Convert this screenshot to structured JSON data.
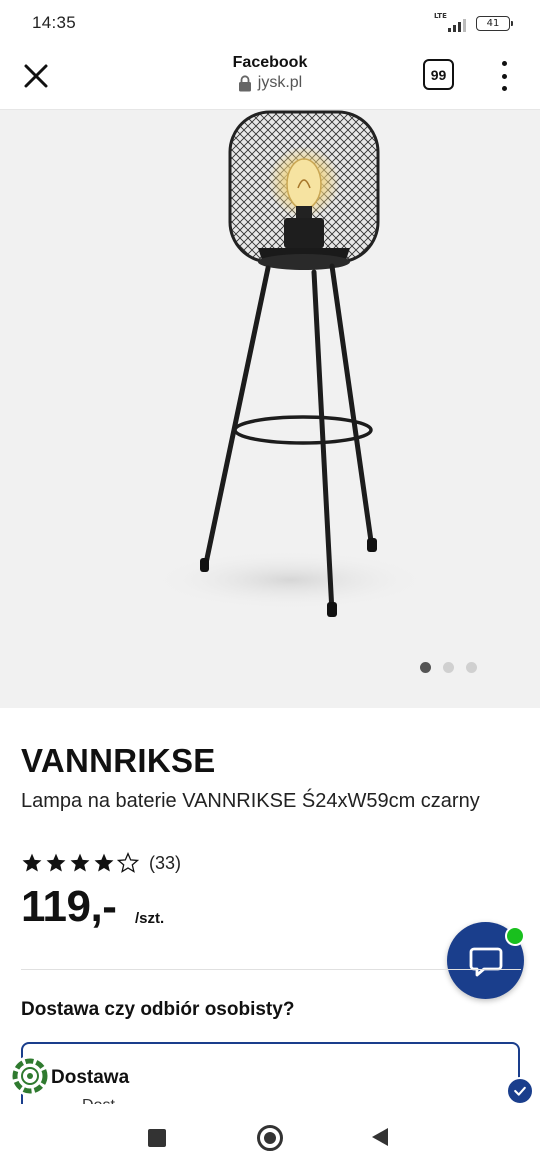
{
  "status_bar": {
    "time": "14:35",
    "network": "LTE",
    "battery": "41"
  },
  "browser": {
    "title": "Facebook",
    "domain": "jysk.pl",
    "tab_count": "99",
    "icons": [
      "close-icon",
      "lock-icon",
      "more-vert-icon"
    ]
  },
  "gallery": {
    "image_count": 3,
    "active_index": 0
  },
  "product": {
    "name": "VANNRIKSE",
    "description": "Lampa na baterie VANNRIKSE Ś24xW59cm czarny",
    "rating": 4,
    "rating_max": 5,
    "review_count": "(33)",
    "price": "119,-",
    "unit": "/szt."
  },
  "delivery": {
    "heading": "Dostawa czy odbiór osobisty?",
    "option_label": "Dostawa",
    "option_sub": "Dost",
    "selected": true
  },
  "colors": {
    "brand_blue": "#1a3e8c",
    "online_green": "#19c01e"
  }
}
